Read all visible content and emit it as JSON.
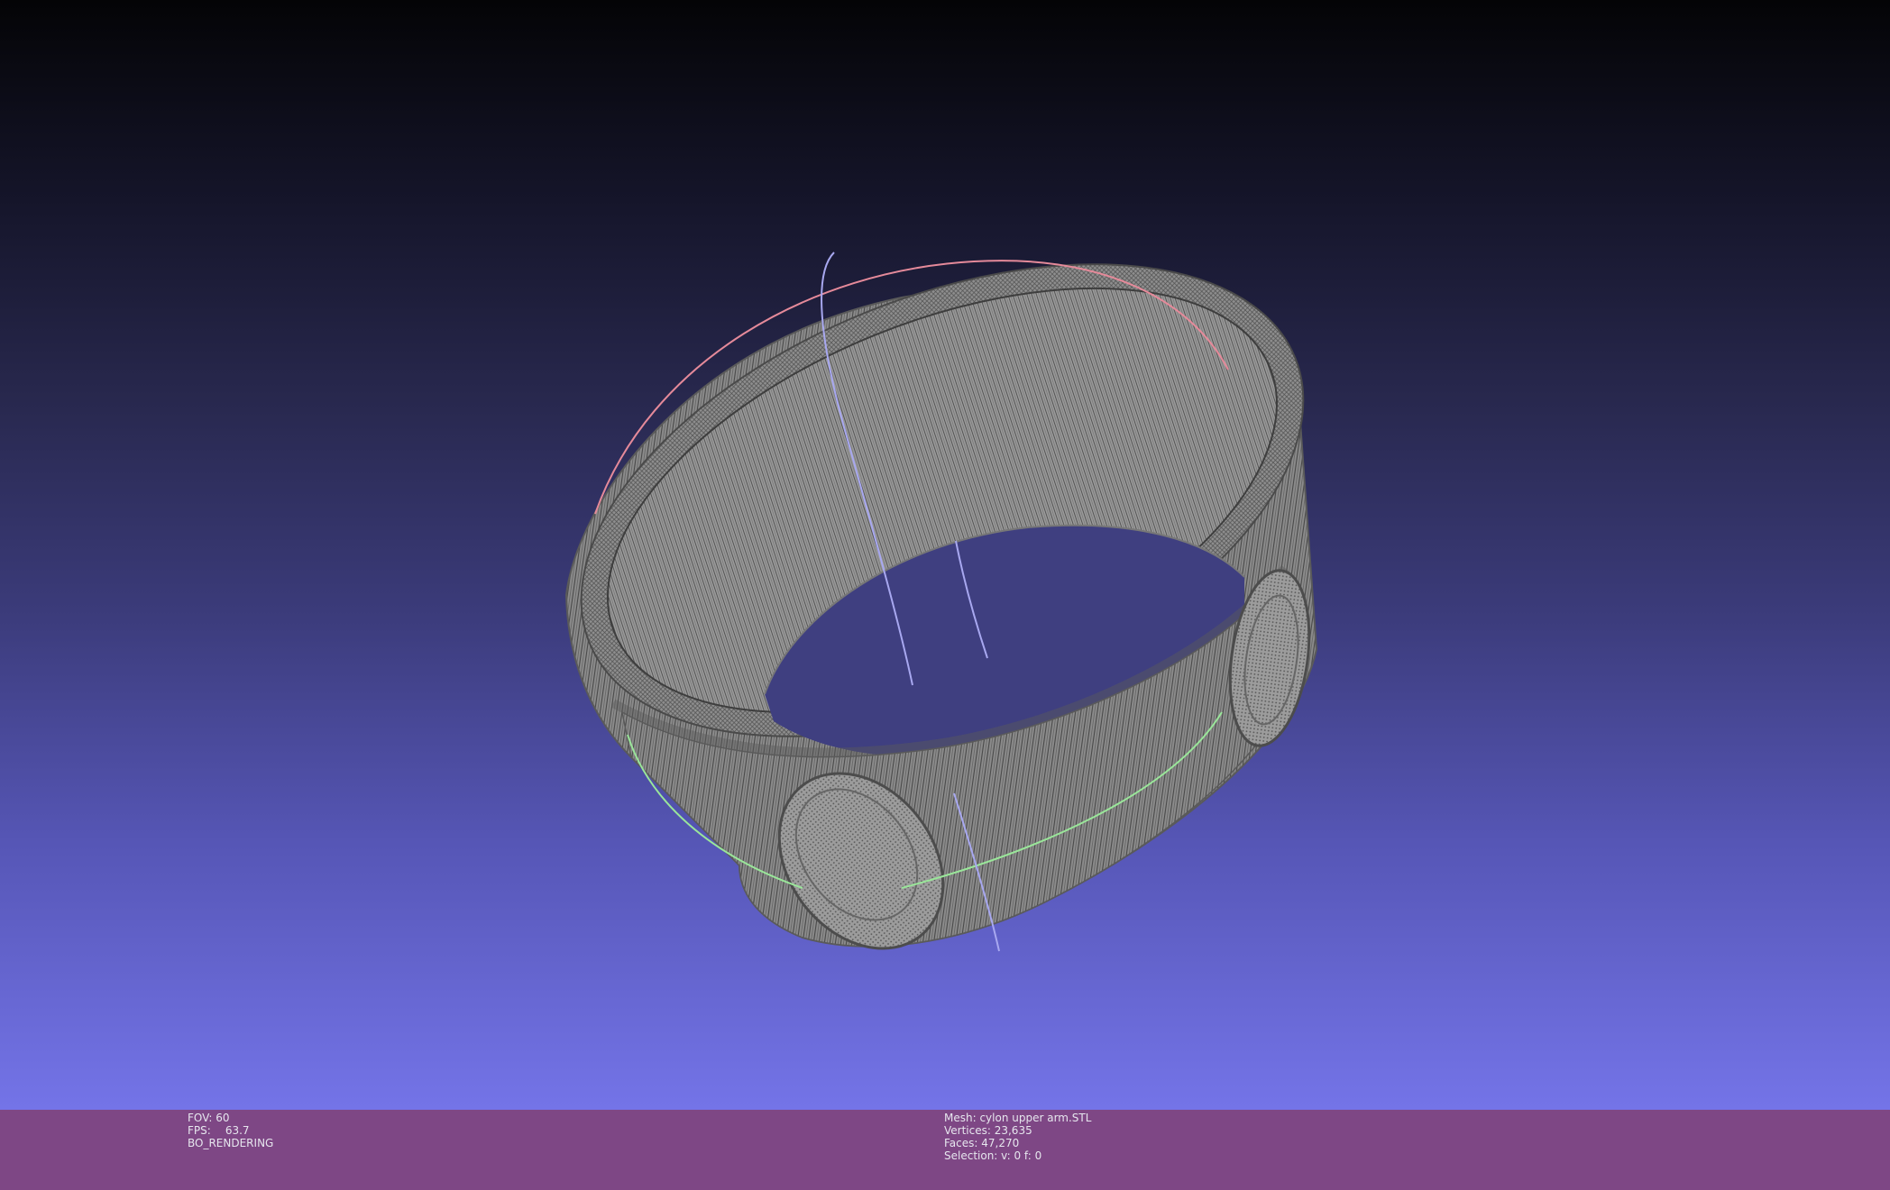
{
  "viewer": {
    "background_top": "#040406",
    "background_bottom": "#7474e8",
    "mesh_color": "#8a8a8a",
    "trackball_colors": {
      "x_axis": "#e58a9a",
      "y_axis": "#9ae69a",
      "z_axis": "#a8a8f0"
    }
  },
  "status_left": {
    "fov": "FOV: 60",
    "fps_label": "FPS:",
    "fps_value": "63.7",
    "mode": "BO_RENDERING"
  },
  "status_right": {
    "mesh": "Mesh: cylon upper arm.STL",
    "vertices": "Vertices: 23,635",
    "faces": "Faces: 47,270",
    "selection": "Selection: v: 0 f: 0"
  },
  "status_bar_color": "#7e4785"
}
